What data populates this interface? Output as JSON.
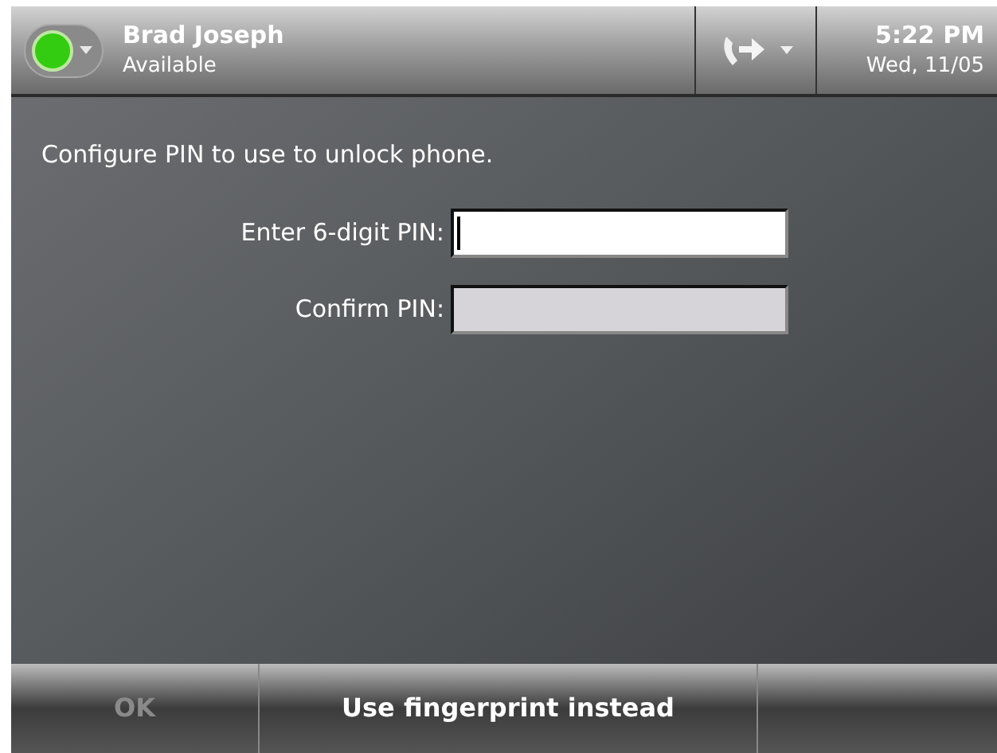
{
  "header": {
    "presence": {
      "name": "Brad Joseph",
      "status": "Available",
      "color": "#33cc11"
    },
    "time": "5:22 PM",
    "date": "Wed, 11/05"
  },
  "prompt": "Configure PIN to use to unlock phone.",
  "fields": [
    {
      "label": "Enter 6-digit PIN:",
      "focused": true
    },
    {
      "label": "Confirm PIN:",
      "focused": false
    }
  ],
  "softkeys": [
    {
      "label": "OK",
      "disabled": true
    },
    {
      "label": "Use fingerprint instead",
      "disabled": false
    }
  ]
}
